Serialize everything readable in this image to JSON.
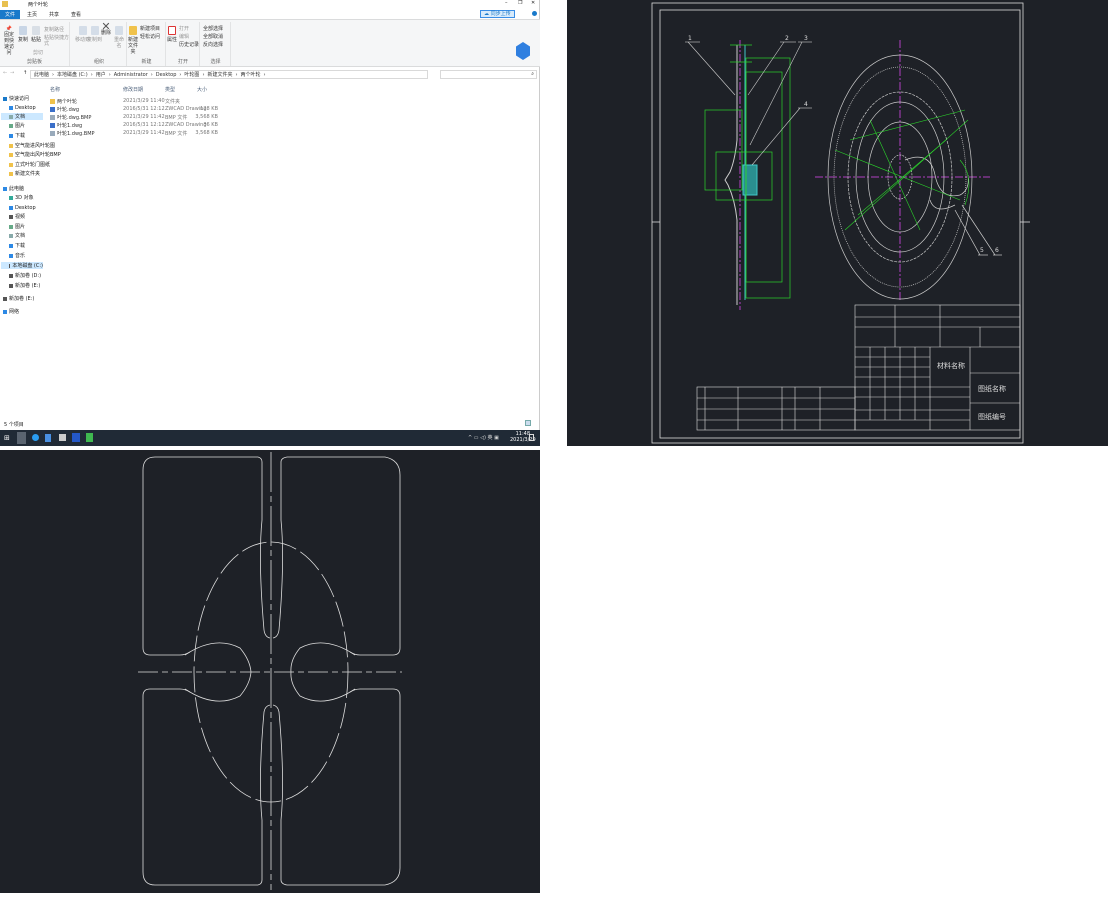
{
  "explorer": {
    "title": "两个叶轮",
    "tabs": [
      {
        "label": "文件",
        "active": true
      },
      {
        "label": "主页"
      },
      {
        "label": "共享"
      },
      {
        "label": "查看"
      }
    ],
    "sync_button": "同步上传",
    "ribbon": {
      "groups": [
        "剪贴板",
        "组织",
        "新建",
        "打开",
        "选择"
      ],
      "pin": "固定到快速访问",
      "copy": "复制",
      "paste": "粘贴",
      "copy_path": "复制路径",
      "paste_shortcut": "粘贴快捷方式",
      "cut": "剪切",
      "move_to": "移动到",
      "copy_to": "复制到",
      "delete": "删除",
      "rename": "重命名",
      "new_folder": "新建文件夹",
      "new_item": "新建项目",
      "easy_access": "轻松访问",
      "properties": "属性",
      "open": "打开",
      "edit": "编辑",
      "history": "历史记录",
      "select_all": "全部选择",
      "select_none": "全部取消",
      "invert": "反向选择"
    },
    "path": [
      "此电脑",
      "本地磁盘 (C:)",
      "用户",
      "Administrator",
      "Desktop",
      "叶轮图",
      "新建文件夹",
      "两个叶轮"
    ],
    "search_placeholder": "",
    "columns": [
      "名称",
      "修改日期",
      "类型",
      "大小"
    ],
    "files": [
      {
        "name": "两个叶轮",
        "date": "2021/3/29 11:40",
        "type": "文件夹",
        "size": "",
        "icon": "folder"
      },
      {
        "name": "叶轮.dwg",
        "date": "2016/5/31 12:12",
        "type": "ZWCAD Drawing",
        "size": "128 KB",
        "icon": "dwg"
      },
      {
        "name": "叶轮.dwg.BMP",
        "date": "2021/3/29 11:42",
        "type": "BMP 文件",
        "size": "3,568 KB",
        "icon": "bmp"
      },
      {
        "name": "叶轮1.dwg",
        "date": "2016/5/31 12:12",
        "type": "ZWCAD Drawing",
        "size": "36 KB",
        "icon": "dwg"
      },
      {
        "name": "叶轮1.dwg.BMP",
        "date": "2021/3/29 11:42",
        "type": "BMP 文件",
        "size": "3,568 KB",
        "icon": "bmp"
      }
    ],
    "sidebar": [
      {
        "label": "快速访问",
        "icon": "star",
        "level": 0
      },
      {
        "label": "Desktop",
        "icon": "desktop",
        "level": 1
      },
      {
        "label": "文档",
        "icon": "docs",
        "level": 1,
        "selected": true
      },
      {
        "label": "图片",
        "icon": "pictures",
        "level": 1
      },
      {
        "label": "下载",
        "icon": "download",
        "level": 1
      },
      {
        "label": "空气能进风叶轮图",
        "icon": "folder",
        "level": 1
      },
      {
        "label": "空气能出风叶轮BMP",
        "icon": "folder",
        "level": 1
      },
      {
        "label": "立式叶轮门图纸",
        "icon": "folder",
        "level": 1
      },
      {
        "label": "新建文件夹",
        "icon": "folder",
        "level": 1
      },
      {
        "label": "此电脑",
        "icon": "pc",
        "level": 0
      },
      {
        "label": "3D 对象",
        "icon": "3d",
        "level": 1
      },
      {
        "label": "Desktop",
        "icon": "desktop",
        "level": 1
      },
      {
        "label": "视频",
        "icon": "video",
        "level": 1
      },
      {
        "label": "图片",
        "icon": "pictures",
        "level": 1
      },
      {
        "label": "文档",
        "icon": "docs",
        "level": 1
      },
      {
        "label": "下载",
        "icon": "download",
        "level": 1
      },
      {
        "label": "音乐",
        "icon": "music",
        "level": 1
      },
      {
        "label": "本地磁盘 (C:)",
        "icon": "drive",
        "level": 1,
        "selected": true
      },
      {
        "label": "新加卷 (D:)",
        "icon": "drive",
        "level": 1
      },
      {
        "label": "新加卷 (E:)",
        "icon": "drive",
        "level": 1
      },
      {
        "label": "新加卷 (E:)",
        "icon": "drive",
        "level": 0
      },
      {
        "label": "网络",
        "icon": "network",
        "level": 0
      }
    ],
    "status": "5 个项目"
  },
  "taskbar": {
    "time": "11:48",
    "date": "2021/3/29"
  },
  "cad_drawing": {
    "part_labels": [
      "1",
      "2",
      "3",
      "4",
      "5",
      "6"
    ],
    "title_block": {
      "material": "材料名称",
      "drawing_name": "图纸名称",
      "drawing_number": "图纸编号"
    }
  },
  "colors": {
    "accent": "#1979ca",
    "cad_bg": "#1e2127",
    "cad_green": "#2bd62b",
    "cad_magenta": "#b040c0",
    "cad_cyan": "#40c8c8",
    "taskbar": "#202a36"
  }
}
